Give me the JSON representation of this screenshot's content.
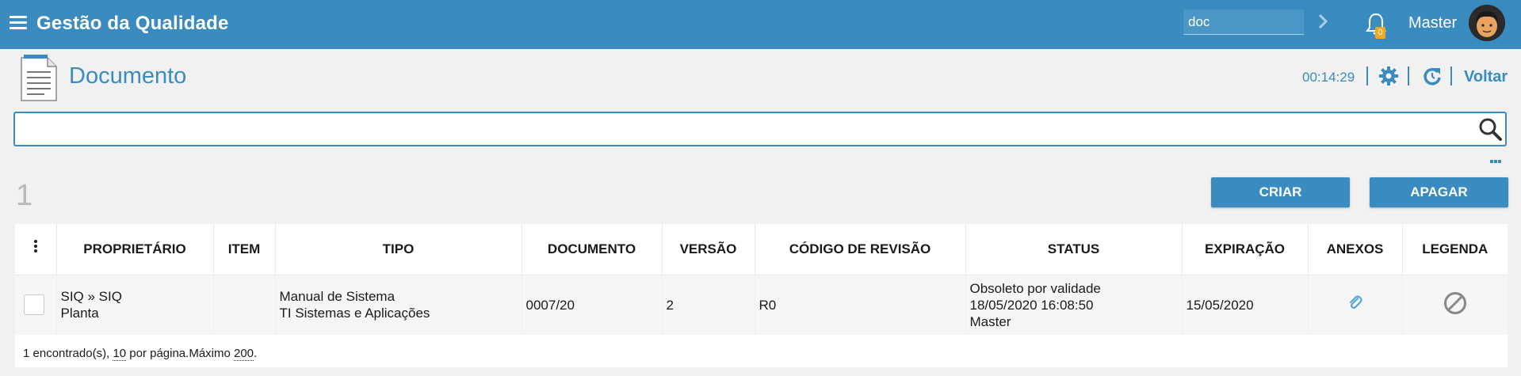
{
  "header": {
    "title": "Gestão da Qualidade",
    "search_value": "doc",
    "notifications_count": "0",
    "user_name": "Master"
  },
  "page": {
    "title": "Documento",
    "timer": "00:14:29",
    "back_label": "Voltar"
  },
  "search": {
    "value": ""
  },
  "results": {
    "count": "1",
    "create_label": "CRIAR",
    "delete_label": "APAGAR"
  },
  "table": {
    "columns": [
      "PROPRIETÁRIO",
      "ITEM",
      "TIPO",
      "DOCUMENTO",
      "VERSÃO",
      "CÓDIGO DE REVISÃO",
      "STATUS",
      "EXPIRAÇÃO",
      "ANEXOS",
      "LEGENDA"
    ],
    "rows": [
      {
        "owner_line1": "SIQ » SIQ",
        "owner_line2": "Planta",
        "item": "",
        "type_line1": "Manual de Sistema",
        "type_line2": "TI Sistemas e Aplicações",
        "document": "0007/20",
        "version": "2",
        "revision_code": "R0",
        "status_line1": "Obsoleto por validade",
        "status_line2": "18/05/2020 16:08:50",
        "status_line3": "Master",
        "expiration": "15/05/2020"
      }
    ],
    "footer": {
      "found": "1 encontrado(s), ",
      "per_page": "10",
      "per_page_label": " por página.Máximo ",
      "max": "200",
      "end": "."
    }
  },
  "colors": {
    "primary": "#3a8bbf",
    "badge": "#f5a623"
  },
  "icons": [
    "menu-icon",
    "chevron-right-icon",
    "bell-icon",
    "avatar",
    "document-icon",
    "gear-icon",
    "refresh-icon",
    "search-icon",
    "more-icon",
    "kebab-icon",
    "paperclip-icon",
    "ban-icon"
  ]
}
